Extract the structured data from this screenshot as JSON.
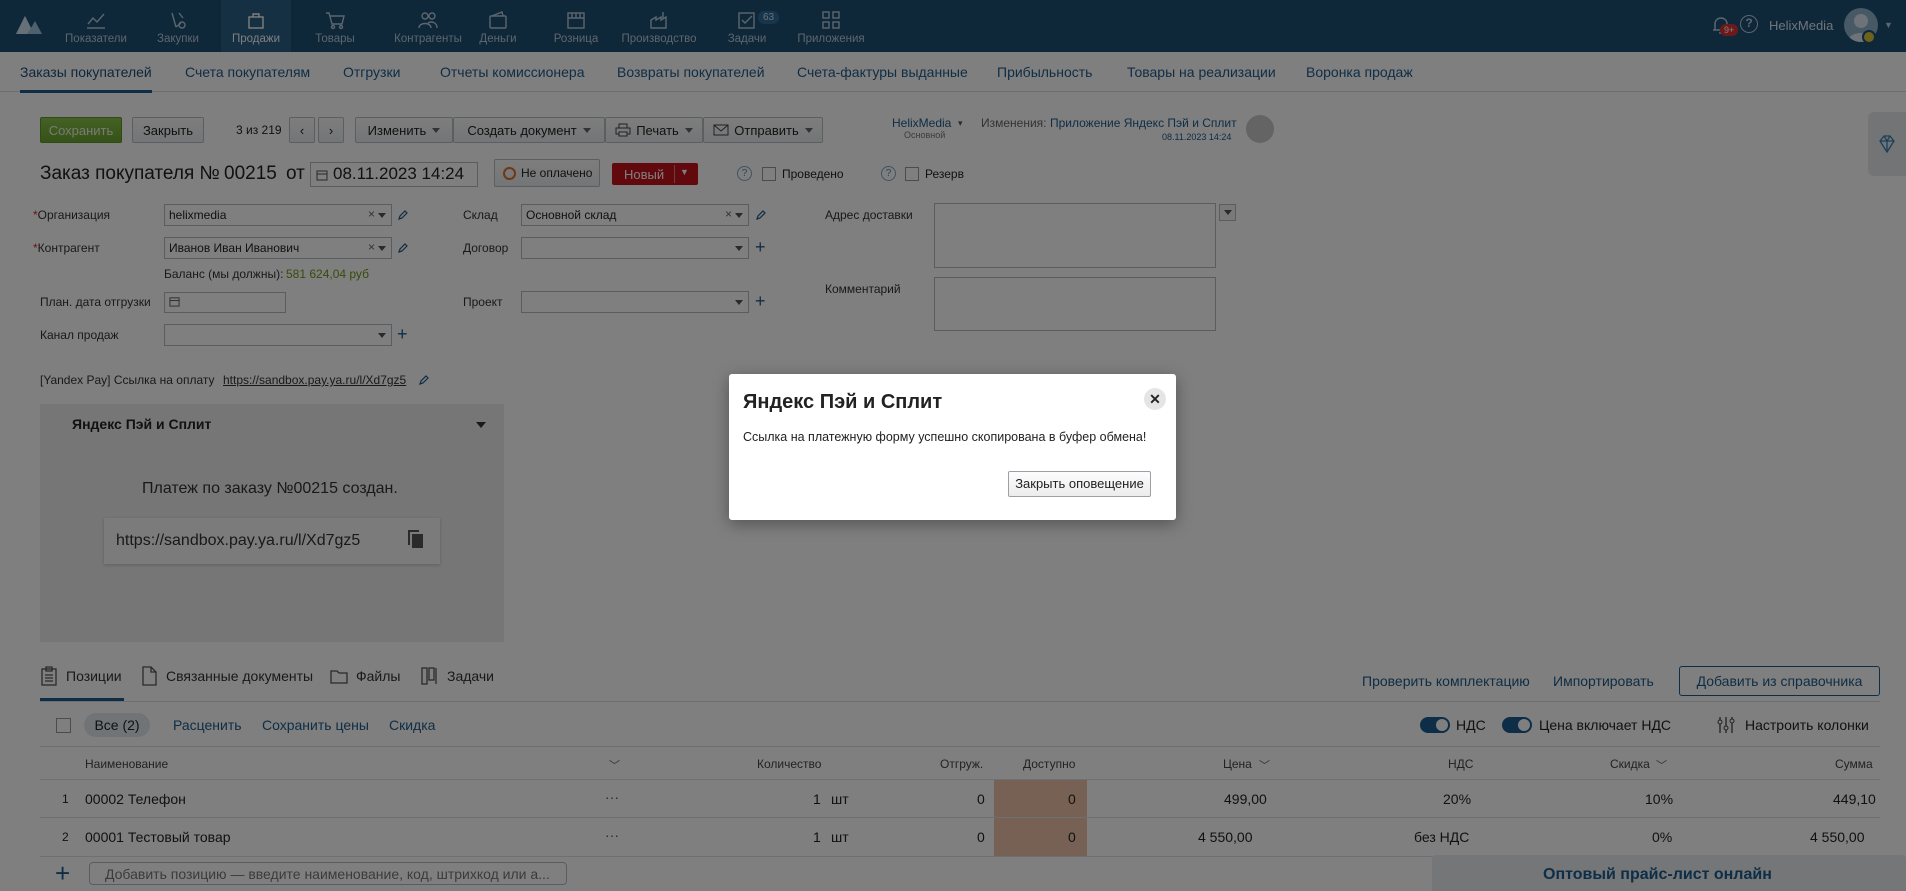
{
  "nav": {
    "items": [
      {
        "label": "Показатели",
        "icon": "chart-line-icon"
      },
      {
        "label": "Закупки",
        "icon": "basket-icon"
      },
      {
        "label": "Продажи",
        "icon": "bag-icon"
      },
      {
        "label": "Товары",
        "icon": "cart-icon"
      },
      {
        "label": "Контрагенты",
        "icon": "people-icon"
      },
      {
        "label": "Деньги",
        "icon": "wallet-icon"
      },
      {
        "label": "Розница",
        "icon": "store-icon"
      },
      {
        "label": "Производство",
        "icon": "factory-icon"
      },
      {
        "label": "Задачи",
        "icon": "tasks-icon",
        "badge": "63"
      },
      {
        "label": "Приложения",
        "icon": "apps-icon"
      }
    ],
    "notifications_badge": "9+",
    "help": "?",
    "username": "HelixMedia"
  },
  "subnav": [
    "Заказы покупателей",
    "Счета покупателям",
    "Отгрузки",
    "Отчеты комиссионера",
    "Возвраты покупателей",
    "Счета-фактуры выданные",
    "Прибыльность",
    "Товары на реализации",
    "Воронка продаж"
  ],
  "toolbar": {
    "save": "Сохранить",
    "close": "Закрыть",
    "counter": "3 из 219",
    "change": "Изменить",
    "create_doc": "Создать документ",
    "print": "Печать",
    "send": "Отправить",
    "owner": "HelixMedia",
    "owner_sub": "Основной",
    "changes_label": "Изменения:",
    "changes_value": "Приложение Яндекс Пэй и Сплит",
    "changes_date": "08.11.2023 14:24"
  },
  "order": {
    "title": "Заказ покупателя №",
    "number": "00215",
    "from": "от",
    "date": "08.11.2023 14:24",
    "payment_status": "Не оплачено",
    "status": "Новый",
    "conducted": "Проведено",
    "reserve": "Резерв"
  },
  "form": {
    "org_label": "Организация",
    "org_value": "helixmedia",
    "contractor_label": "Контрагент",
    "contractor_value": "Иванов Иван Иванович",
    "balance_label": "Баланс (мы должны):",
    "balance_value": "581 624,04 руб",
    "ship_date_label": "План. дата отгрузки",
    "channel_label": "Канал продаж",
    "warehouse_label": "Склад",
    "warehouse_value": "Основной склад",
    "contract_label": "Договор",
    "project_label": "Проект",
    "address_label": "Адрес доставки",
    "comment_label": "Комментарий",
    "yandex_link_label": "[Yandex Pay] Ссылка на оплату",
    "yandex_link": "https://sandbox.pay.ya.ru/l/Xd7gz5"
  },
  "ypanel": {
    "title": "Яндекс Пэй и Сплит",
    "message": "Платеж по заказу №00215 создан.",
    "url": "https://sandbox.pay.ya.ru/l/Xd7gz5"
  },
  "modal": {
    "title": "Яндекс Пэй и Сплит",
    "message": "Ссылка на платежную форму успешно скопирована в буфер обмена!",
    "button": "Закрыть оповещение"
  },
  "tabs": [
    {
      "label": "Позиции",
      "icon": "clipboard-icon"
    },
    {
      "label": "Связанные документы",
      "icon": "document-icon"
    },
    {
      "label": "Файлы",
      "icon": "folder-icon"
    },
    {
      "label": "Задачи",
      "icon": "kanban-icon"
    }
  ],
  "actions": {
    "check": "Проверить комплектацию",
    "import": "Импортировать",
    "add_from_ref": "Добавить из справочника"
  },
  "filters": {
    "all": "Все (2)",
    "reprice": "Расценить",
    "save_prices": "Сохранить цены",
    "discount": "Скидка",
    "vat": "НДС",
    "price_incl_vat": "Цена включает НДС",
    "columns": "Настроить колонки"
  },
  "table": {
    "headers": {
      "name": "Наименование",
      "qty": "Количество",
      "shipped": "Отгруж.",
      "available": "Доступно",
      "price": "Цена",
      "vat": "НДС",
      "discount": "Скидка",
      "sum": "Сумма"
    },
    "rows": [
      {
        "n": "1",
        "name": "00002 Телефон",
        "more": "···",
        "qty": "1",
        "unit": "шт",
        "shipped": "0",
        "available": "0",
        "price": "499,00",
        "vat": "20%",
        "discount": "10%",
        "sum": "449,10"
      },
      {
        "n": "2",
        "name": "00001 Тестовый товар",
        "more": "···",
        "qty": "1",
        "unit": "шт",
        "shipped": "0",
        "available": "0",
        "price": "4 550,00",
        "vat": "без НДС",
        "discount": "0%",
        "sum": "4 550,00"
      }
    ],
    "add_placeholder": "Добавить позицию — введите наименование, код, штрихкод или а..."
  },
  "promo": "Оптовый прайс-лист онлайн"
}
